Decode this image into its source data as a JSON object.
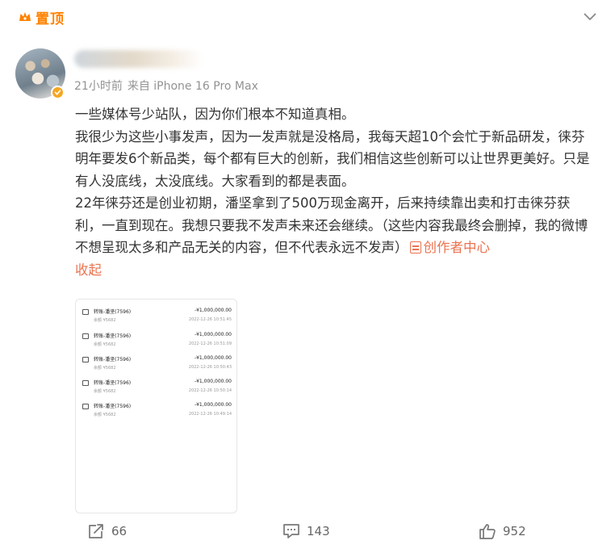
{
  "header": {
    "pin_label": "置顶"
  },
  "post": {
    "time": "21小时前",
    "source": "来自 iPhone 16 Pro Max",
    "paragraphs": [
      "一些媒体号少站队，因为你们根本不知道真相。",
      "我很少为这些小事发声，因为一发声就是没格局，我每天超10个会忙于新品研发，徕芬明年要发6个新品类，每个都有巨大的创新，我们相信这些创新可以让世界更美好。只是有人没底线，太没底线。大家看到的都是表面。",
      "22年徕芬还是创业初期，潘坚拿到了500万现金离开，后来持续靠出卖和打击徕芬获利，一直到现在。我想只要我不发声未来还会继续。（这些内容我最终会删掉，我的微博不想呈现太多和产品无关的内容，但不代表永远不发声）"
    ],
    "creator_link": "创作者中心",
    "collapse_label": "收起"
  },
  "transactions": [
    {
      "title": "转账-潘坚(7596)",
      "amount": "-¥1,000,000.00",
      "balance": "余额 ¥5682",
      "date": "2022-12-26 10:51:45"
    },
    {
      "title": "转账-潘坚(7596)",
      "amount": "-¥1,000,000.00",
      "balance": "余额 ¥5682",
      "date": "2022-12-26 10:51:09"
    },
    {
      "title": "转账-潘坚(7596)",
      "amount": "-¥1,000,000.00",
      "balance": "余额 ¥5682",
      "date": "2022-12-26 10:50:43"
    },
    {
      "title": "转账-潘坚(7596)",
      "amount": "-¥1,000,000.00",
      "balance": "余额 ¥5682",
      "date": "2022-12-26 10:50:14"
    },
    {
      "title": "转账-潘坚(7596)",
      "amount": "-¥1,000,000.00",
      "balance": "余额 ¥5682",
      "date": "2022-12-26 10:49:14"
    }
  ],
  "actions": {
    "repost_count": "66",
    "comment_count": "143",
    "like_count": "952"
  },
  "colors": {
    "accent": "#ff8200",
    "link": "#eb7350",
    "meta": "#939393"
  },
  "icons": {
    "pin": "pin-icon",
    "more": "chevron-down-icon",
    "repost": "repost-icon",
    "comment": "comment-icon",
    "like": "thumbs-up-icon",
    "verified": "verified-badge-icon"
  }
}
